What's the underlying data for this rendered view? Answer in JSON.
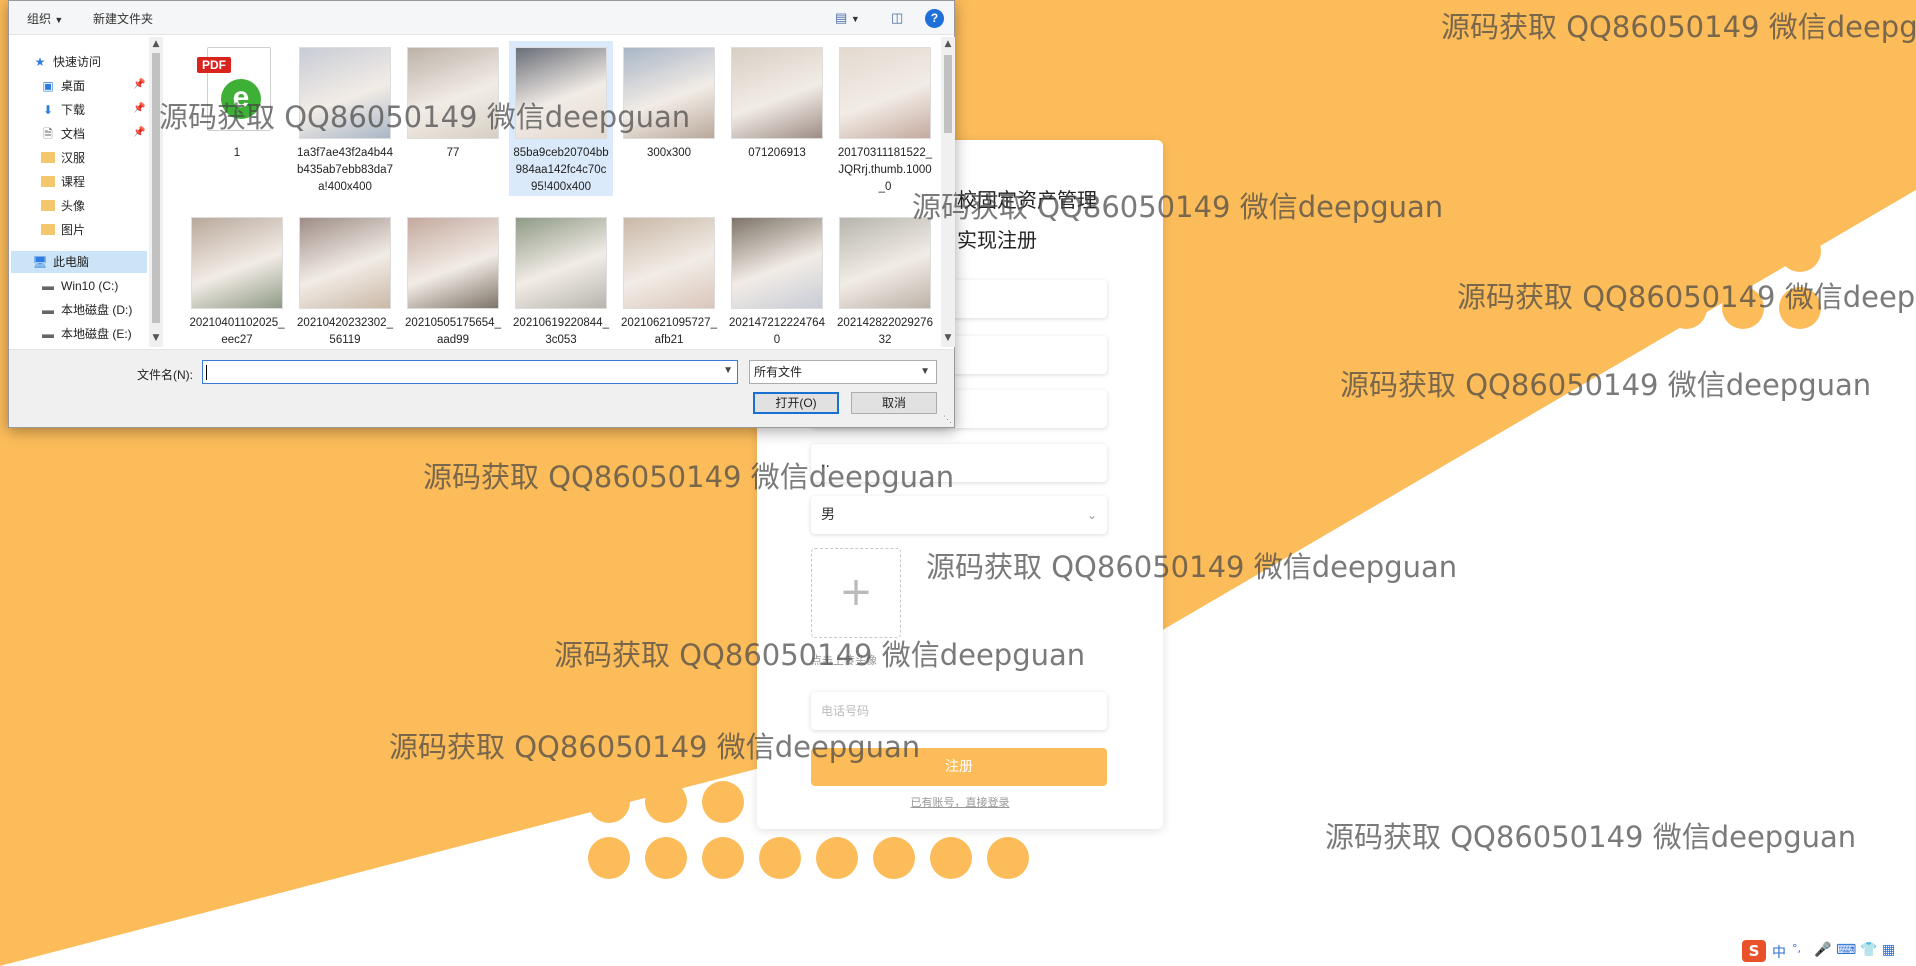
{
  "colors": {
    "accent": "#fcbc5a",
    "select": "#cce4f7",
    "primary_blue": "#1a70d2"
  },
  "dialog": {
    "toolbar": {
      "organize": "组织",
      "new_folder": "新建文件夹",
      "help": "?"
    },
    "nav": {
      "quick_access": "快速访问",
      "desktop": "桌面",
      "downloads": "下载",
      "documents": "文档",
      "folder_hanfu": "汉服",
      "folder_course": "课程",
      "folder_avatar": "头像",
      "folder_pictures": "图片",
      "this_pc": "此电脑",
      "drive_c": "Win10 (C:)",
      "drive_d": "本地磁盘 (D:)",
      "drive_e": "本地磁盘 (E:)"
    },
    "files": [
      {
        "name": "1",
        "type": "pdf"
      },
      {
        "name": "1a3f7ae43f2a4b44b435ab7ebb83da7a!400x400"
      },
      {
        "name": "77"
      },
      {
        "name": "85ba9ceb20704bb984aa142fc4c70c95!400x400",
        "selected": true
      },
      {
        "name": "300x300"
      },
      {
        "name": "071206913"
      },
      {
        "name": "20170311181522_JQRrj.thumb.1000_0"
      },
      {
        "name": "20210401102025_eec27"
      },
      {
        "name": "20210420232302_56119"
      },
      {
        "name": "20210505175654_aad99"
      },
      {
        "name": "20210619220844_3c053"
      },
      {
        "name": "20210621095727_afb21"
      },
      {
        "name": "2021472122247640"
      },
      {
        "name": "20214282202927632"
      }
    ],
    "filename_label": "文件名(N):",
    "filename_value": "",
    "filetype_value": "所有文件",
    "open_label": "打开(O)",
    "cancel_label": "取消"
  },
  "register": {
    "title_line1": "高校固定资产管理",
    "title_line2": "与实现注册",
    "gender_value": "男",
    "upload_plus": "+",
    "upload_label": "点击上传头像",
    "phone_placeholder": "电话号码",
    "password_mask": "..",
    "register_button": "注册",
    "login_link": "已有账号，直接登录"
  },
  "watermark": "源码获取 QQ86050149 微信deepguan",
  "tray": {
    "ime_label": "中",
    "punct": "°,",
    "icons": [
      "sogou-icon",
      "microphone-icon",
      "keyboard-icon",
      "shirt-icon",
      "grid-icon"
    ]
  }
}
